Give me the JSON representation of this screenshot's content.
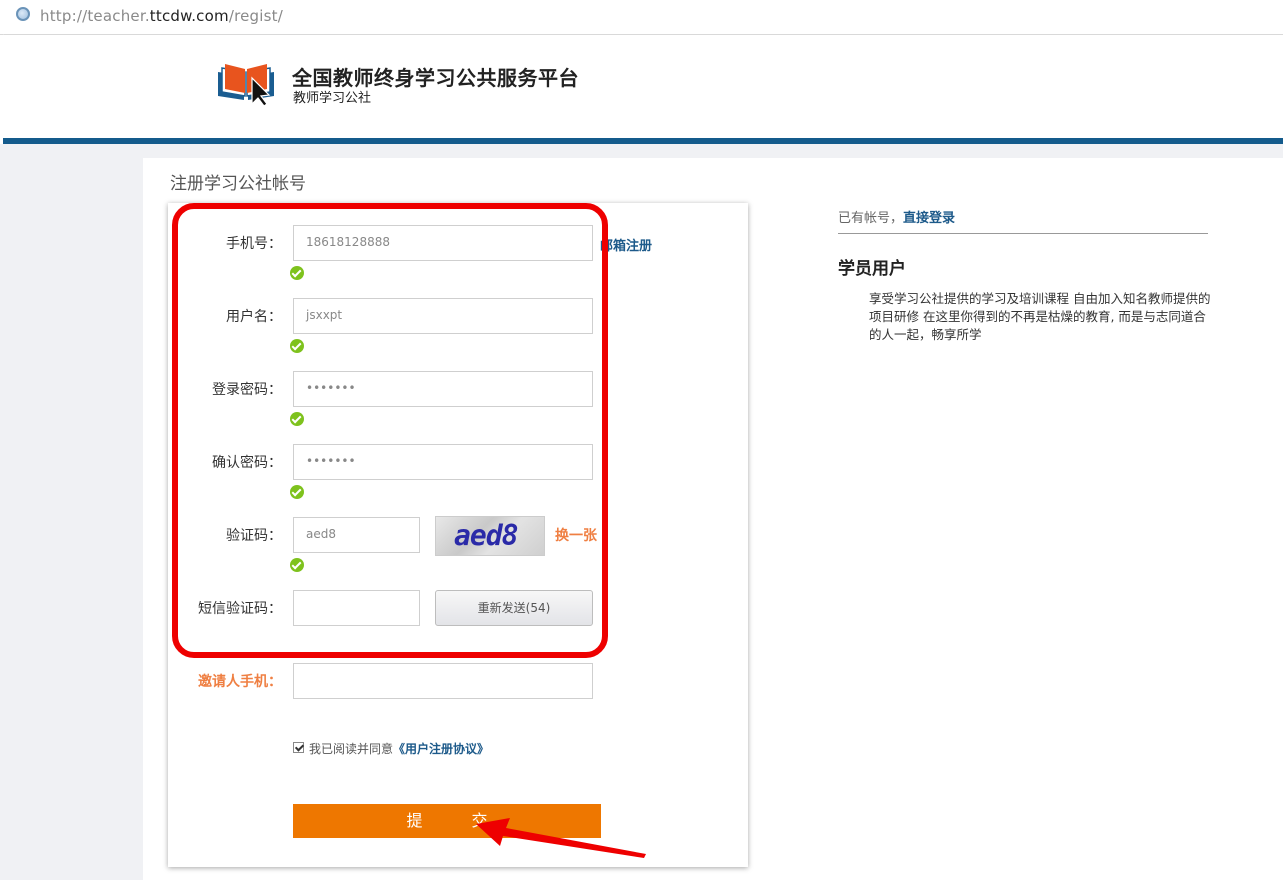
{
  "browser": {
    "url_prefix": "http://teacher.",
    "url_domain": "ttcdw.com",
    "url_path": "/regist/"
  },
  "header": {
    "site_title": "全国教师终身学习公共服务平台",
    "site_subtitle": "教师学习公社"
  },
  "form": {
    "page_title": "注册学习公社帐号",
    "email_register_link": "邮箱注册",
    "fields": {
      "phone": {
        "label": "手机号：",
        "value": "18618128888"
      },
      "username": {
        "label": "用户名：",
        "value": "jsxxpt"
      },
      "password": {
        "label": "登录密码：",
        "value": "•••••••"
      },
      "confirm": {
        "label": "确认密码：",
        "value": "•••••••"
      },
      "captcha": {
        "label": "验证码：",
        "value": "aed8",
        "image_text": "aed8",
        "refresh": "换一张"
      },
      "sms": {
        "label": "短信验证码：",
        "value": "",
        "resend": "重新发送(54)"
      },
      "inviter": {
        "label": "邀请人手机：",
        "value": ""
      }
    },
    "agreement": {
      "text": "我已阅读并同意",
      "link": "《用户注册协议》",
      "checked": true
    },
    "submit": "提 交",
    "colors": {
      "accent_orange": "#ee7700",
      "valid_green": "#7ec21d",
      "link_blue": "#1d5a8a",
      "annotation_red": "#ee0000"
    }
  },
  "sidebar": {
    "has_account": "已有帐号，",
    "login_link": "直接登录",
    "role_title": "学员用户",
    "role_desc": "享受学习公社提供的学习及培训课程 自由加入知名教师提供的项目研修 在这里你得到的不再是枯燥的教育, 而是与志同道合的人一起，畅享所学"
  }
}
